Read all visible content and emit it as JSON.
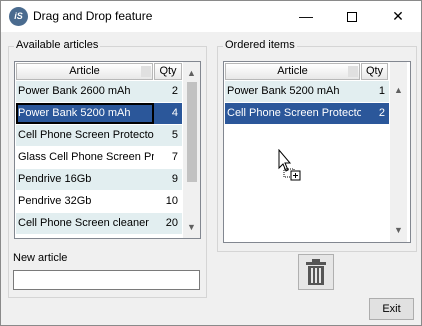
{
  "window": {
    "title": "Drag and Drop feature",
    "app_icon_text": "iS",
    "minimize_symbol": "—",
    "close_symbol": "✕"
  },
  "available": {
    "group_title": "Available articles",
    "headers": {
      "article": "Article",
      "qty": "Qty"
    },
    "rows": [
      {
        "article": "Power Bank 2600 mAh",
        "qty": "2"
      },
      {
        "article": "Power Bank 5200 mAh",
        "qty": "4"
      },
      {
        "article": "Cell Phone Screen Protector",
        "qty": "5"
      },
      {
        "article": "Glass Cell Phone Screen Protector",
        "qty": "7"
      },
      {
        "article": "Pendrive 16Gb",
        "qty": "9"
      },
      {
        "article": "Pendrive 32Gb",
        "qty": "10"
      },
      {
        "article": "Cell Phone Screen cleaner",
        "qty": "20"
      }
    ],
    "selected_index": 1,
    "new_article_label": "New article",
    "new_article_value": ""
  },
  "ordered": {
    "group_title": "Ordered items",
    "headers": {
      "article": "Article",
      "qty": "Qty"
    },
    "rows": [
      {
        "article": "Power Bank 5200 mAh",
        "qty": "1"
      },
      {
        "article": "Cell Phone Screen Protector",
        "qty": "2"
      }
    ],
    "selected_index": 1
  },
  "buttons": {
    "exit_label": "Exit",
    "trash_icon": "trash-icon"
  },
  "scroll": {
    "up": "▲",
    "down": "▼"
  },
  "colors": {
    "selection": "#2b579a",
    "alt_row": "#e2eef0",
    "window_bg": "#f0f0f0"
  }
}
